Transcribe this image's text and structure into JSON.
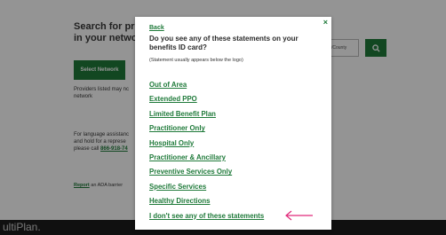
{
  "background": {
    "search_title_line1": "Search for provid",
    "search_title_line2": "in your network",
    "select_network_button": "Select Network",
    "providers_note_line1": "Providers listed may nc",
    "providers_note_line2": "network",
    "language_line1": "For language assistanc",
    "language_line2": "and hold for a represe",
    "language_line3_prefix": "please call ",
    "language_phone": "866-918-74",
    "report_link": "Report",
    "report_suffix": " an ADA barrier",
    "county_placeholder": "/County",
    "brand": "ultiPlan."
  },
  "modal": {
    "back_link": "Back",
    "close_glyph": "×",
    "question": "Do you see any of these statements on your benefits ID card?",
    "note": "(Statement usually appears below the logo)",
    "options": [
      "Out of Area",
      "Extended PPO",
      "Limited Benefit Plan",
      "Practitioner Only",
      "Hospital Only",
      "Practitioner & Ancillary",
      "Preventive Services Only",
      "Specific Services",
      "Healthy Directions",
      "I don't see any of these statements"
    ]
  },
  "colors": {
    "accent": "#1f7a3a",
    "annotation_arrow": "#e0297a"
  }
}
